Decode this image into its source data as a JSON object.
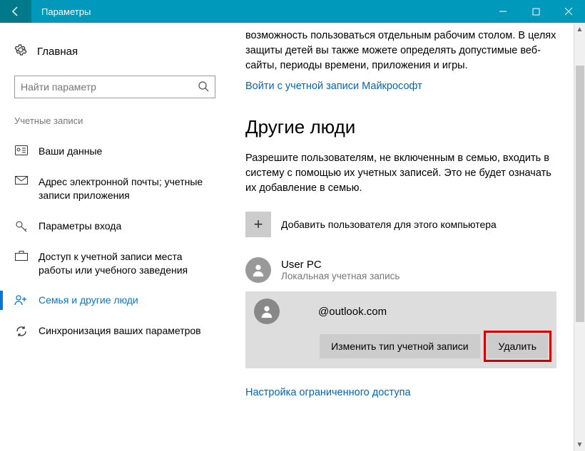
{
  "titlebar": {
    "title": "Параметры"
  },
  "sidebar": {
    "home": "Главная",
    "search_placeholder": "Найти параметр",
    "section": "Учетные записи",
    "items": [
      {
        "label": "Ваши данные"
      },
      {
        "label": "Адрес электронной почты; учетные записи приложения"
      },
      {
        "label": "Параметры входа"
      },
      {
        "label": "Доступ к учетной записи места работы или учебного заведения"
      },
      {
        "label": "Семья и другие люди"
      },
      {
        "label": "Синхронизация ваших параметров"
      }
    ]
  },
  "content": {
    "intro_text": "возможность пользоваться отдельным рабочим столом. В целях защиты детей вы также можете определять допустимые веб-сайты, периоды времени, приложения и игры.",
    "signin_link": "Войти с учетной записи Майкрософт",
    "section_title": "Другие люди",
    "section_desc": "Разрешите пользователям, не включенным в семью, входить в систему с помощью их учетных записей. Это не будет означать их добавление в семью.",
    "add_user_label": "Добавить пользователя для этого компьютера",
    "user1": {
      "name": "User PC",
      "type": "Локальная учетная запись"
    },
    "user2": {
      "name": "@outlook.com"
    },
    "button_change": "Изменить тип учетной записи",
    "button_delete": "Удалить",
    "restricted_link": "Настройка ограниченного доступа"
  }
}
